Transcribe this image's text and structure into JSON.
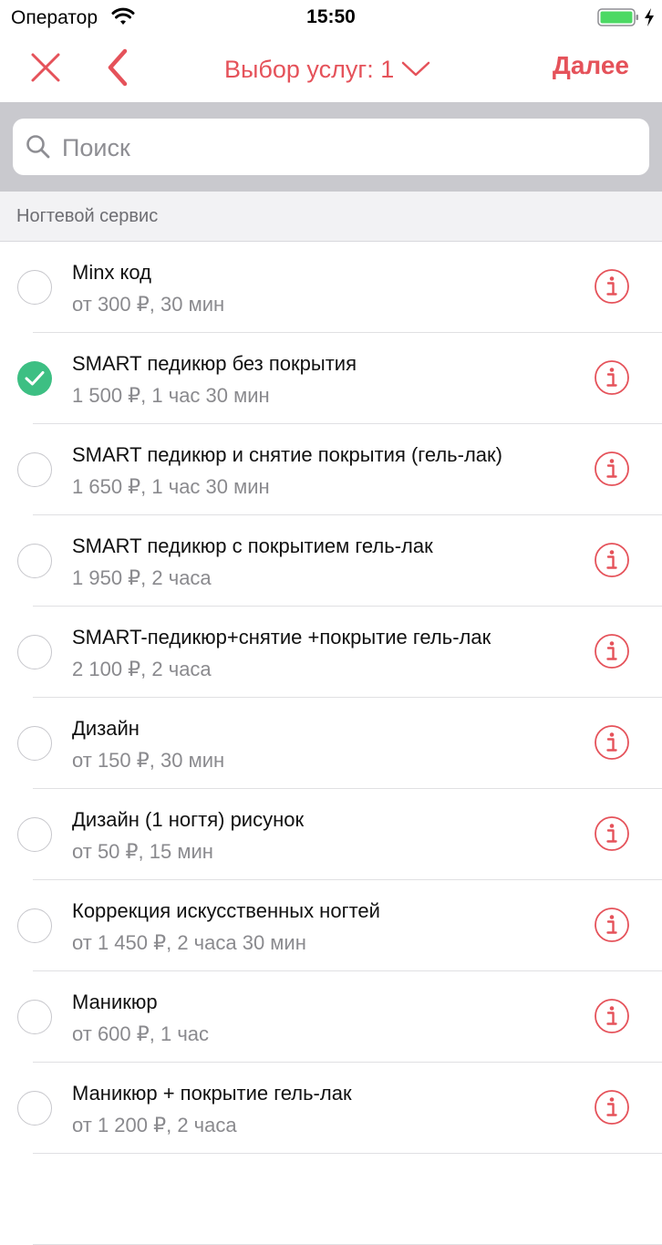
{
  "status_bar": {
    "carrier": "Оператор",
    "time": "15:50"
  },
  "nav": {
    "title": "Выбор услуг: 1",
    "next_label": "Далее",
    "accent_color": "#e5525a"
  },
  "search": {
    "placeholder": "Поиск",
    "value": ""
  },
  "section": {
    "title": "Ногтевой сервис"
  },
  "services": [
    {
      "name": "Minx код",
      "meta": "от 300 ₽,  30 мин",
      "checked": false
    },
    {
      "name": "SMART педикюр без покрытия",
      "meta": "1 500 ₽, 1 час 30 мин",
      "checked": true
    },
    {
      "name": "SMART педикюр и снятие покрытия (гель-лак)",
      "meta": "1 650 ₽, 1 час 30 мин",
      "checked": false
    },
    {
      "name": "SMART педикюр с покрытием гель-лак",
      "meta": "1 950 ₽, 2 часа",
      "checked": false
    },
    {
      "name": "SMART-педикюр+снятие +покрытие гель-лак",
      "meta": "2 100 ₽, 2 часа",
      "checked": false
    },
    {
      "name": "Дизайн",
      "meta": "от 150 ₽,  30 мин",
      "checked": false
    },
    {
      "name": "Дизайн  (1 ногтя) рисунок",
      "meta": "от 50 ₽,  15 мин",
      "checked": false
    },
    {
      "name": "Коррекция искусственных ногтей",
      "meta": "от 1 450 ₽, 2 часа 30 мин",
      "checked": false
    },
    {
      "name": "Маникюр",
      "meta": "от 600 ₽, 1 час",
      "checked": false
    },
    {
      "name": "Маникюр + покрытие гель-лак",
      "meta": "от 1 200 ₽, 2 часа",
      "checked": false
    }
  ],
  "icons": {
    "close": "close-icon",
    "back": "chevron-left-icon",
    "title_chevron": "chevron-down-icon",
    "search": "search-icon",
    "info": "info-icon",
    "check": "checkmark-icon"
  },
  "colors": {
    "accent": "#e5525a",
    "checked": "#3dbf83",
    "battery": "#4cd964"
  }
}
